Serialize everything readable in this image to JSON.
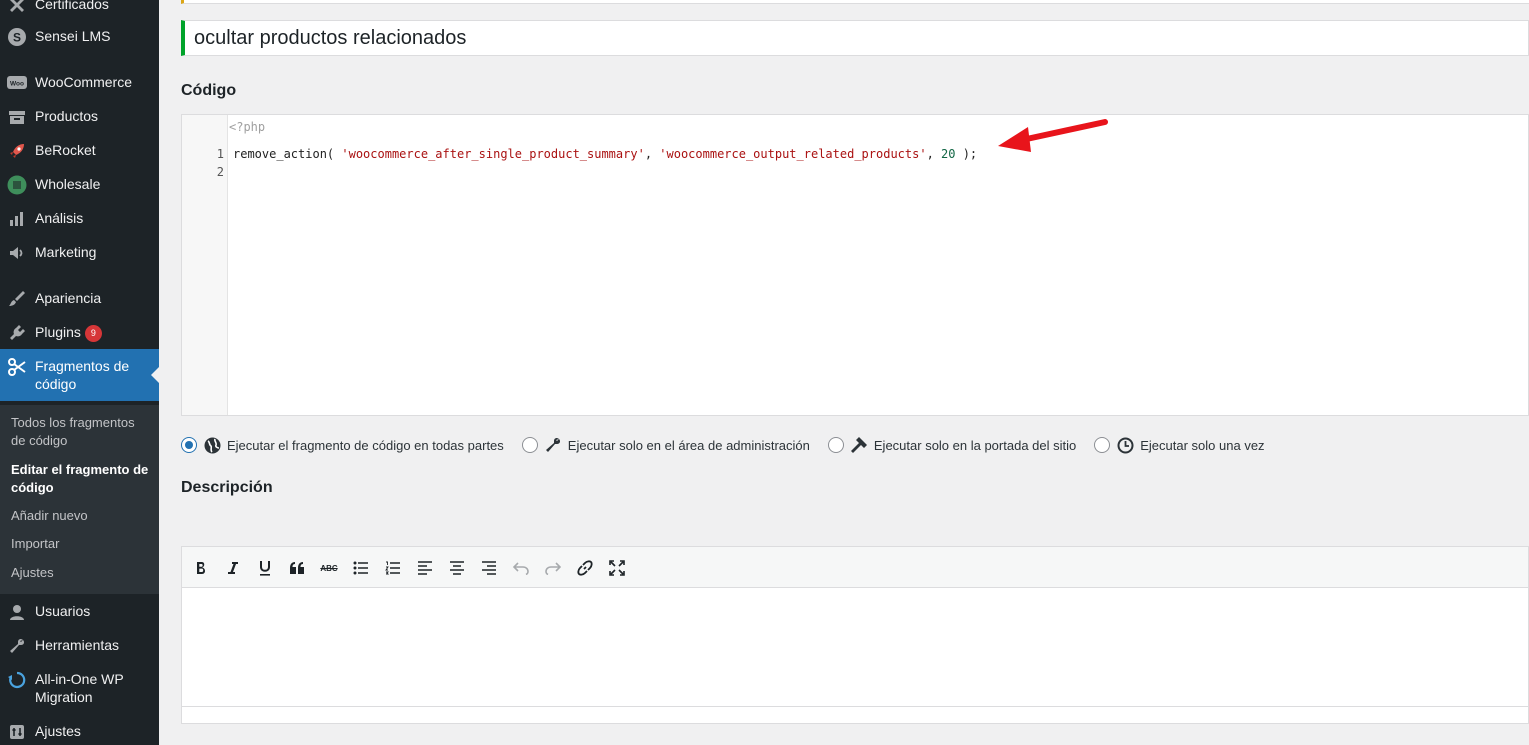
{
  "sidebar": {
    "items": [
      {
        "label": "Certificados",
        "icon": "certificate-icon"
      },
      {
        "label": "Sensei LMS",
        "icon": "sensei-icon"
      },
      {
        "label": "WooCommerce",
        "icon": "woocommerce-icon"
      },
      {
        "label": "Productos",
        "icon": "products-icon"
      },
      {
        "label": "BeRocket",
        "icon": "rocket-icon"
      },
      {
        "label": "Wholesale",
        "icon": "wholesale-icon"
      },
      {
        "label": "Análisis",
        "icon": "chart-icon"
      },
      {
        "label": "Marketing",
        "icon": "megaphone-icon"
      },
      {
        "label": "Apariencia",
        "icon": "brush-icon"
      },
      {
        "label": "Plugins",
        "icon": "plugin-icon",
        "badge": "9"
      },
      {
        "label": "Fragmentos de código",
        "icon": "scissors-icon"
      },
      {
        "label": "Usuarios",
        "icon": "user-icon"
      },
      {
        "label": "Herramientas",
        "icon": "wrench-icon"
      },
      {
        "label": "All-in-One WP Migration",
        "icon": "migration-icon"
      },
      {
        "label": "Ajustes",
        "icon": "settings-icon"
      }
    ],
    "submenu": [
      {
        "label": "Todos los fragmentos de código"
      },
      {
        "label": "Editar el fragmento de código"
      },
      {
        "label": "Añadir nuevo"
      },
      {
        "label": "Importar"
      },
      {
        "label": "Ajustes"
      }
    ],
    "active_color": "#2271b1",
    "badge_color": "#d63638"
  },
  "main": {
    "snippet_title": "ocultar productos relacionados",
    "code_heading": "Código",
    "code": {
      "php_tag": "<?php",
      "line_numbers": [
        "1",
        "2"
      ],
      "line1": {
        "func": "remove_action( ",
        "arg1": "'woocommerce_after_single_product_summary'",
        "sep1": ", ",
        "arg2": "'woocommerce_output_related_products'",
        "sep2": ", ",
        "arg3": "20",
        "end": " );"
      }
    },
    "scope_options": [
      {
        "label": "Ejecutar el fragmento de código en todas partes",
        "icon": "globe-icon",
        "checked": true
      },
      {
        "label": "Ejecutar solo en el área de administración",
        "icon": "wrench-icon",
        "checked": false
      },
      {
        "label": "Ejecutar solo en la portada del sitio",
        "icon": "hammer-icon",
        "checked": false
      },
      {
        "label": "Ejecutar solo una vez",
        "icon": "clock-icon",
        "checked": false
      }
    ],
    "description_heading": "Descripción",
    "toolbar_buttons": [
      "bold-icon",
      "italic-icon",
      "underline-icon",
      "blockquote-icon",
      "strikethrough-icon",
      "bullet-list-icon",
      "numbered-list-icon",
      "align-left-icon",
      "align-center-icon",
      "align-right-icon",
      "undo-icon",
      "redo-icon",
      "link-icon",
      "fullscreen-icon"
    ],
    "annotation_arrow_color": "#e8141b"
  }
}
